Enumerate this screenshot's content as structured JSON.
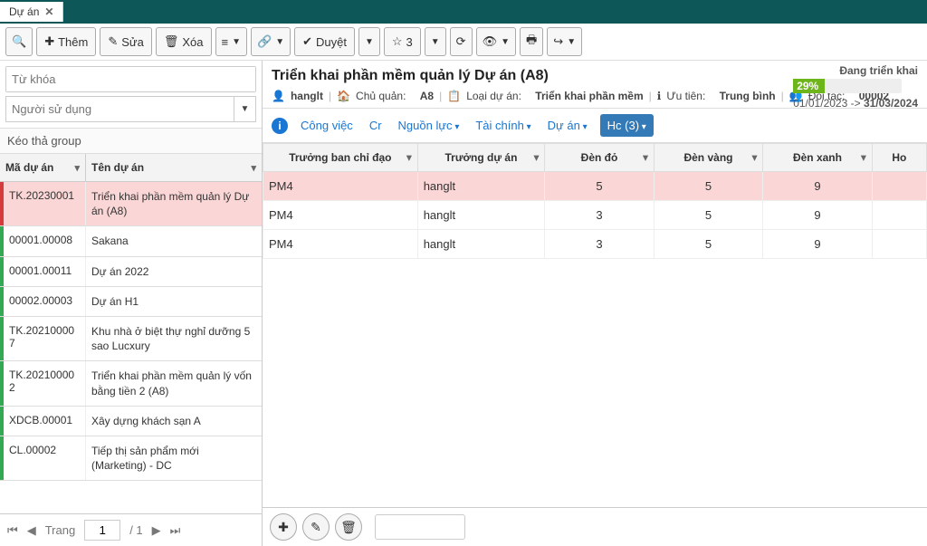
{
  "app": {
    "tab_label": "Dự án"
  },
  "toolbar": {
    "add": "Thêm",
    "edit": "Sửa",
    "delete": "Xóa",
    "approve": "Duyệt",
    "star_count": "3"
  },
  "filters": {
    "keyword_placeholder": "Từ khóa",
    "user_placeholder": "Người sử dụng",
    "group_hint": "Kéo thả group"
  },
  "left_cols": {
    "code": "Mã dự án",
    "name": "Tên dự án"
  },
  "projects": [
    {
      "code": "TK.20230001",
      "name": "Triển khai phần mềm quản lý Dự án (A8)",
      "selected": true,
      "bar": "red"
    },
    {
      "code": "00001.00008",
      "name": "Sakana",
      "bar": "green"
    },
    {
      "code": "00001.00011",
      "name": "Dự án 2022",
      "bar": "green"
    },
    {
      "code": "00002.00003",
      "name": "Dự án H1",
      "bar": "green"
    },
    {
      "code": "TK.202100007",
      "name": "Khu nhà ở biệt thự nghỉ dưỡng 5 sao Lucxury",
      "bar": "green"
    },
    {
      "code": "TK.202100002",
      "name": "Triển khai phần mềm quản lý vốn bằng tiền 2 (A8)",
      "bar": "green"
    },
    {
      "code": "XDCB.00001",
      "name": "Xây dựng khách sạn A",
      "bar": "green"
    },
    {
      "code": "CL.00002",
      "name": "Tiếp thị sản phẩm mới (Marketing) - DC",
      "bar": "green"
    }
  ],
  "pager": {
    "label": "Trang",
    "page": "1",
    "total": "/ 1"
  },
  "detail": {
    "title": "Triển khai phần mềm quản lý Dự án (A8)",
    "user": "hanglt",
    "owner_label": "Chủ quản:",
    "owner": "A8",
    "type_label": "Loại dự án:",
    "type": "Triển khai phần mềm",
    "priority_label": "Ưu tiên:",
    "priority": "Trung bình",
    "partner_label": "Đối tác:",
    "partner": "00002",
    "status_label": "Đang triển khai",
    "progress": "29%",
    "date_from": "01/01/2023",
    "date_to": "31/03/2024"
  },
  "detail_tabs": {
    "work": "Công việc",
    "cr": "Cr",
    "resource": "Nguồn lực",
    "finance": "Tài chính",
    "project": "Dự án",
    "active": "Hc (3)"
  },
  "grid_cols": {
    "leader": "Trưởng ban chỉ đạo",
    "pm": "Trưởng dự án",
    "red": "Đèn đỏ",
    "yellow": "Đèn vàng",
    "green": "Đèn xanh",
    "more": "Ho"
  },
  "grid_rows": [
    {
      "leader": "PM4",
      "pm": "hanglt",
      "red": "5",
      "yellow": "5",
      "green": "9",
      "sel": true
    },
    {
      "leader": "PM4",
      "pm": "hanglt",
      "red": "3",
      "yellow": "5",
      "green": "9"
    },
    {
      "leader": "PM4",
      "pm": "hanglt",
      "red": "3",
      "yellow": "5",
      "green": "9"
    }
  ]
}
